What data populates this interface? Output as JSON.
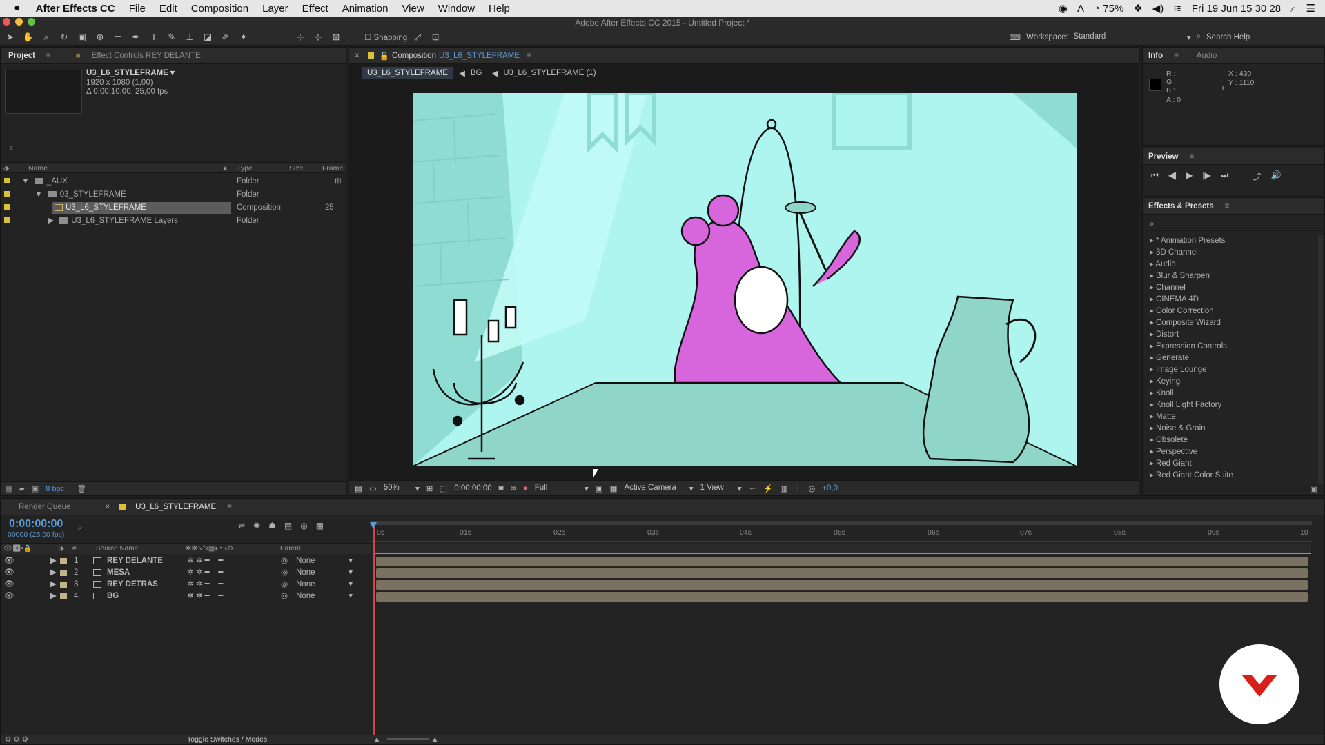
{
  "menubar": {
    "app_name": "After Effects CC",
    "items": [
      "File",
      "Edit",
      "Composition",
      "Layer",
      "Effect",
      "Animation",
      "View",
      "Window",
      "Help"
    ],
    "battery": "75%",
    "datetime": "Fri 19 Jun  15 30 28"
  },
  "window": {
    "title": "Adobe After Effects CC 2015 - Untitled Project *"
  },
  "toolbar": {
    "snapping_label": "Snapping",
    "workspace_label": "Workspace:",
    "workspace_value": "Standard",
    "search_help": "Search Help"
  },
  "project": {
    "tab": "Project",
    "tab_effect_controls": "Effect Controls REY DELANTE",
    "selected_name": "U3_L6_STYLEFRAME ▾",
    "selected_dims": "1920 x 1080 (1,00)",
    "selected_duration": "Δ 0:00:10:00, 25,00 fps",
    "columns": {
      "name": "Name",
      "type": "Type",
      "size": "Size",
      "frame": "Frame ."
    },
    "items": [
      {
        "name": "_AUX",
        "type": "Folder",
        "frames": ""
      },
      {
        "name": "03_STYLEFRAME",
        "type": "Folder",
        "frames": ""
      },
      {
        "name": "U3_L6_STYLEFRAME",
        "type": "Composition",
        "frames": "25"
      },
      {
        "name": "U3_L6_STYLEFRAME Layers",
        "type": "Folder",
        "frames": ""
      }
    ],
    "bpc": "8 bpc"
  },
  "composition": {
    "tab_prefix": "Composition",
    "tab_name": "U3_L6_STYLEFRAME",
    "breadcrumbs": [
      "U3_L6_STYLEFRAME",
      "BG",
      "U3_L6_STYLEFRAME (1)"
    ],
    "zoom": "50%",
    "timecode": "0:00:00:00",
    "resolution": "Full",
    "camera": "Active Camera",
    "views": "1 View",
    "exposure": "+0,0"
  },
  "info": {
    "tab": "Info",
    "tab_audio": "Audio",
    "r": "R :",
    "g": "G :",
    "b": "B :",
    "a": "A : 0",
    "x": "X : 430",
    "y": "Y : 1110"
  },
  "preview": {
    "title": "Preview"
  },
  "effects": {
    "title": "Effects & Presets",
    "items": [
      "* Animation Presets",
      "3D Channel",
      "Audio",
      "Blur & Sharpen",
      "Channel",
      "CINEMA 4D",
      "Color Correction",
      "Composite Wizard",
      "Distort",
      "Expression Controls",
      "Generate",
      "Image Lounge",
      "Keying",
      "Knoll",
      "Knoll Light Factory",
      "Matte",
      "Noise & Grain",
      "Obsolete",
      "Perspective",
      "Red Giant",
      "Red Giant Color Suite"
    ]
  },
  "timeline": {
    "tab_render": "Render Queue",
    "tab_comp": "U3_L6_STYLEFRAME",
    "timecode": "0:00:00:00",
    "frame_info": "00000 (25.00 fps)",
    "col_num": "#",
    "col_source": "Source Name",
    "col_parent": "Parent",
    "ticks": [
      "0s",
      "01s",
      "02s",
      "03s",
      "04s",
      "05s",
      "06s",
      "07s",
      "08s",
      "09s",
      "10"
    ],
    "layers": [
      {
        "num": "1",
        "name": "REY DELANTE",
        "parent": "None"
      },
      {
        "num": "2",
        "name": "MESA",
        "parent": "None"
      },
      {
        "num": "3",
        "name": "REY DETRAS",
        "parent": "None"
      },
      {
        "num": "4",
        "name": "BG",
        "parent": "None"
      }
    ],
    "toggle_label": "Toggle Switches / Modes"
  }
}
